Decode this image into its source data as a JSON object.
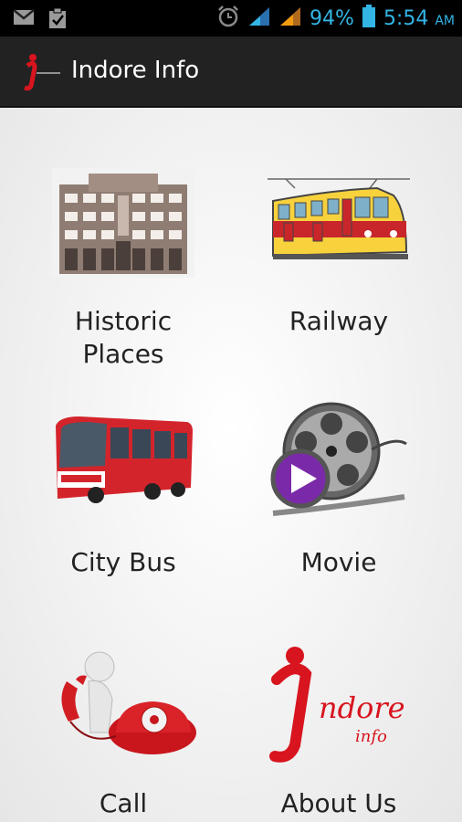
{
  "status_bar": {
    "battery": "94%",
    "time": "5:54",
    "ampm": "AM",
    "icons": [
      "gmail-icon",
      "clipboard-icon",
      "alarm-icon",
      "signal-icon",
      "signal-icon",
      "battery-icon"
    ]
  },
  "action_bar": {
    "title": "Indore Info",
    "logo": "indore-info-logo"
  },
  "tiles": [
    {
      "label": "Historic Places",
      "icon": "palace-icon"
    },
    {
      "label": "Railway",
      "icon": "train-icon"
    },
    {
      "label": "City Bus",
      "icon": "bus-icon"
    },
    {
      "label": "Movie",
      "icon": "film-reel-icon"
    },
    {
      "label": "Call",
      "icon": "phone-icon"
    },
    {
      "label": "About Us",
      "icon": "indore-info-logo"
    }
  ],
  "colors": {
    "accent": "#33b5e5",
    "brand_red": "#d8141e",
    "action_bar": "#222222"
  }
}
